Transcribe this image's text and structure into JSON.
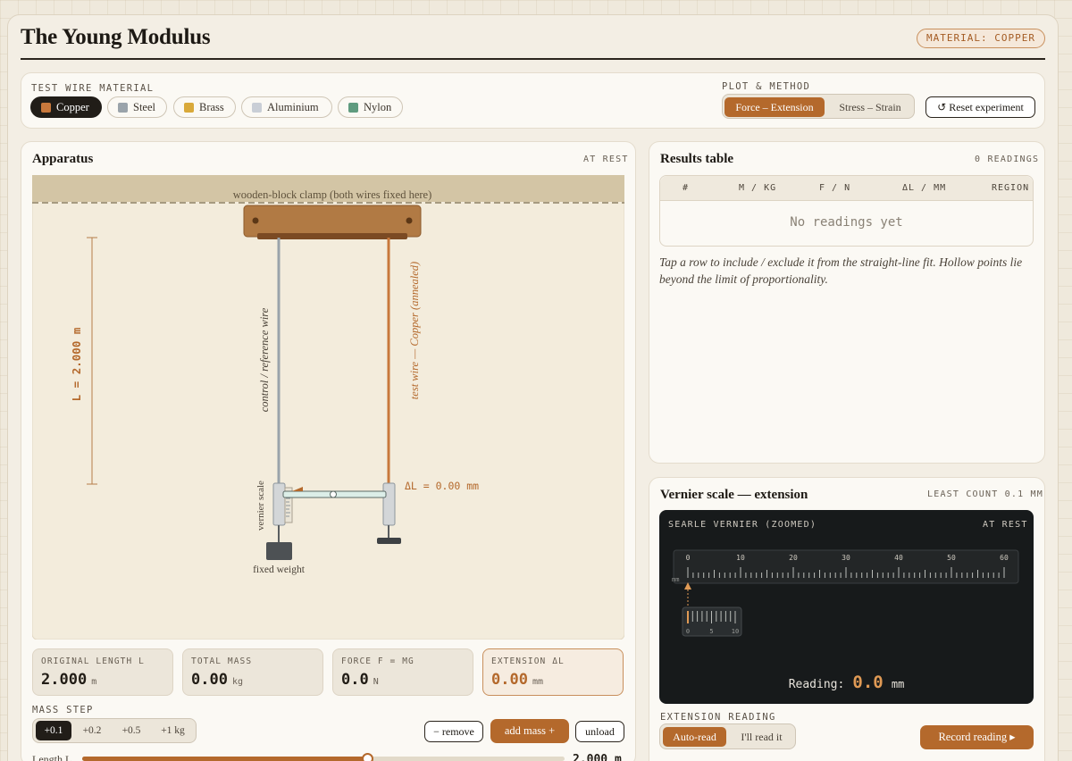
{
  "header": {
    "title": "The Young Modulus",
    "material_badge": "MATERIAL: COPPER"
  },
  "controls": {
    "material_label": "TEST WIRE MATERIAL",
    "materials": [
      {
        "label": "Copper",
        "color": "#c8783c",
        "active": true
      },
      {
        "label": "Steel",
        "color": "#9aa3aa",
        "active": false
      },
      {
        "label": "Brass",
        "color": "#d9a93a",
        "active": false
      },
      {
        "label": "Aluminium",
        "color": "#c9ced6",
        "active": false
      },
      {
        "label": "Nylon",
        "color": "#5f9b7f",
        "active": false
      }
    ],
    "plot_label": "PLOT & METHOD",
    "plot_options": [
      "Force – Extension",
      "Stress – Strain"
    ],
    "plot_selected": "Force – Extension",
    "reset_label": "↺ Reset experiment"
  },
  "apparatus": {
    "title": "Apparatus",
    "status": "AT REST",
    "clamp_label": "wooden-block clamp (both wires fixed here)",
    "length_label": "L = 2.000 m",
    "control_wire_label": "control / reference wire",
    "test_wire_label": "test wire — Copper (annealed)",
    "vernier_label": "vernier scale",
    "fixed_weight_label": "fixed weight",
    "extension_label": "ΔL = 0.00 mm",
    "stats": [
      {
        "label": "ORIGINAL LENGTH L",
        "value": "2.000",
        "unit": "m"
      },
      {
        "label": "TOTAL MASS",
        "value": "0.00",
        "unit": "kg"
      },
      {
        "label": "FORCE F = MG",
        "value": "0.0",
        "unit": "N"
      },
      {
        "label": "EXTENSION ΔL",
        "value": "0.00",
        "unit": "mm"
      }
    ],
    "mass_step_label": "MASS STEP",
    "mass_steps": [
      "+0.1",
      "+0.2",
      "+0.5",
      "+1 kg"
    ],
    "mass_step_selected": "+0.1",
    "remove_label": "− remove",
    "add_label": "add mass +",
    "unload_label": "unload",
    "length_slider_label": "Length L",
    "length_slider_value": "2.000 m",
    "length_slider_fraction": 0.59
  },
  "results": {
    "title": "Results table",
    "count": "0 READINGS",
    "columns": [
      "#",
      "M / KG",
      "F / N",
      "ΔL / MM",
      "REGION"
    ],
    "empty_text": "No readings yet",
    "note": "Tap a row to include / exclude it from the straight-line fit. Hollow points lie beyond the limit of proportionality."
  },
  "vernier": {
    "title": "Vernier scale — extension",
    "least_count": "LEAST COUNT 0.1 MM",
    "panel_title": "SEARLE VERNIER (ZOOMED)",
    "panel_status": "AT REST",
    "main_scale_ticks": [
      "0",
      "10",
      "20",
      "30",
      "40",
      "50",
      "60"
    ],
    "main_scale_unit": "mm",
    "vernier_ticks": [
      "0",
      "5",
      "10"
    ],
    "reading_label": "Reading:",
    "reading_value": "0.0",
    "reading_unit": "mm",
    "extension_reading_label": "EXTENSION READING",
    "read_modes": [
      "Auto-read",
      "I'll read it"
    ],
    "read_mode_selected": "Auto-read",
    "record_label": "Record reading ▸"
  },
  "colors": {
    "accent": "#b4692c",
    "dark": "#211d18",
    "panel_bg": "#171a1b"
  }
}
